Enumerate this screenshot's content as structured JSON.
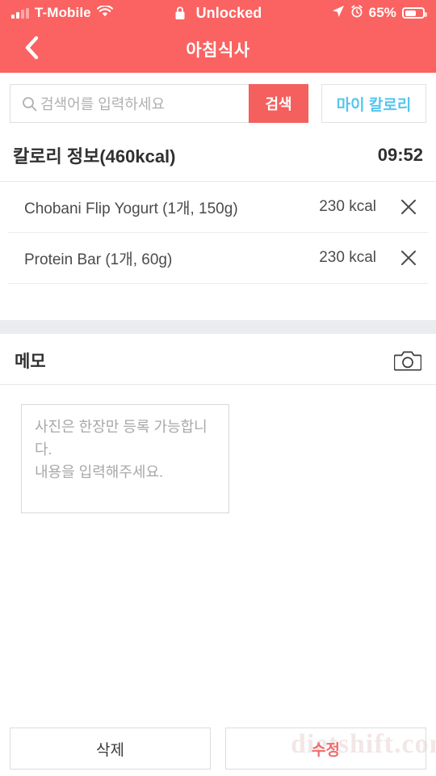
{
  "statusbar": {
    "carrier": "T-Mobile",
    "wifi_icon": "wifi-icon",
    "signal_icon": "signal-bars-icon",
    "lock_icon": "lock-icon",
    "lock_status": "Unlocked",
    "location_icon": "location-arrow-icon",
    "alarm_icon": "alarm-clock-icon",
    "battery_percent": "65%",
    "battery_icon": "battery-icon"
  },
  "navbar": {
    "back_icon": "chevron-left-icon",
    "title": "아침식사"
  },
  "search": {
    "icon": "search-icon",
    "placeholder": "검색어를 입력하세요",
    "value": "",
    "search_button": "검색",
    "my_calorie_button": "마이 칼로리"
  },
  "calorie_section": {
    "title": "칼로리 정보(460kcal)",
    "total_kcal": 460,
    "time": "09:52",
    "remove_icon": "close-x-icon",
    "items": [
      {
        "name": "Chobani Flip Yogurt (1개, 150g)",
        "kcal": "230 kcal"
      },
      {
        "name": "Protein Bar (1개, 60g)",
        "kcal": "230 kcal"
      }
    ]
  },
  "memo": {
    "label": "메모",
    "camera_icon": "camera-icon",
    "placeholder": "사진은 한장만 등록 가능합니다.\n내용을 입력해주세요.",
    "value": ""
  },
  "footer": {
    "delete_button": "삭제",
    "edit_button": "수정"
  },
  "watermark": {
    "text": "dietshift.com"
  },
  "colors": {
    "brand_red": "#fa6361",
    "search_button_red": "#f4605e",
    "accent_blue": "#54c6ef",
    "edit_red": "#f26b6b",
    "separator_gray": "#ebecf0"
  }
}
